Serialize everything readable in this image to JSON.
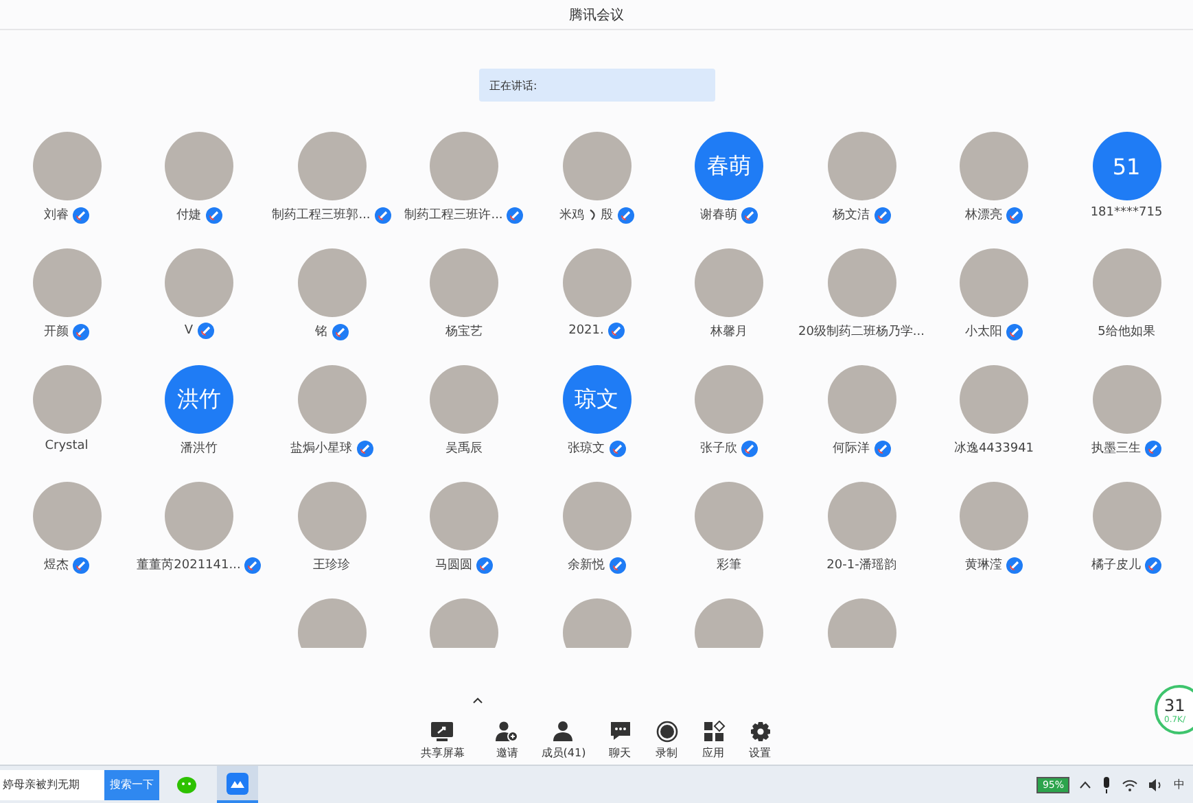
{
  "window": {
    "title": "腾讯会议"
  },
  "speaking": {
    "label": "正在讲话:"
  },
  "participants": [
    {
      "name": "刘睿",
      "verified": true,
      "kind": "photo"
    },
    {
      "name": "付婕",
      "verified": true,
      "kind": "photo"
    },
    {
      "name": "制药工程三班郭...",
      "verified": true,
      "kind": "photo"
    },
    {
      "name": "制药工程三班许...",
      "verified": true,
      "kind": "photo"
    },
    {
      "name": "米鸡",
      "name_end": "殷",
      "verified": true,
      "kind": "photo"
    },
    {
      "name": "谢春萌",
      "verified": true,
      "kind": "initials",
      "initials": "春萌"
    },
    {
      "name": "杨文洁",
      "verified": true,
      "kind": "photo"
    },
    {
      "name": "林漂亮",
      "verified": true,
      "kind": "photo"
    },
    {
      "name": "181****715",
      "verified": false,
      "kind": "initials",
      "initials": "51"
    },
    {
      "name": "开颜",
      "verified": true,
      "kind": "photo"
    },
    {
      "name": "V",
      "verified": true,
      "kind": "photo"
    },
    {
      "name": "铭",
      "verified": true,
      "kind": "photo"
    },
    {
      "name": "杨宝艺",
      "verified": false,
      "kind": "photo"
    },
    {
      "name": "2021.",
      "verified": true,
      "kind": "photo"
    },
    {
      "name": "林馨月",
      "verified": false,
      "kind": "photo"
    },
    {
      "name": "20级制药二班杨乃学...",
      "verified": false,
      "kind": "photo"
    },
    {
      "name": "小太阳",
      "verified": true,
      "kind": "photo"
    },
    {
      "name": "5给他如果",
      "verified": false,
      "kind": "photo"
    },
    {
      "name": "Crystal",
      "verified": false,
      "kind": "photo"
    },
    {
      "name": "潘洪竹",
      "verified": false,
      "kind": "initials",
      "initials": "洪竹"
    },
    {
      "name": "盐焗小星球",
      "verified": true,
      "kind": "photo"
    },
    {
      "name": "吴禹辰",
      "verified": false,
      "kind": "photo"
    },
    {
      "name": "张琼文",
      "verified": true,
      "kind": "initials",
      "initials": "琼文"
    },
    {
      "name": "张子欣",
      "verified": true,
      "kind": "photo"
    },
    {
      "name": "何际洋",
      "verified": true,
      "kind": "photo"
    },
    {
      "name": "冰逸4433941",
      "verified": false,
      "kind": "photo"
    },
    {
      "name": "执墨三生",
      "verified": true,
      "kind": "photo"
    },
    {
      "name": "煜杰",
      "verified": true,
      "kind": "photo"
    },
    {
      "name": "董董芮2021141...",
      "verified": true,
      "kind": "photo"
    },
    {
      "name": "王珍珍",
      "verified": false,
      "kind": "photo"
    },
    {
      "name": "马圆圆",
      "verified": true,
      "kind": "photo"
    },
    {
      "name": "余新悦",
      "verified": true,
      "kind": "photo"
    },
    {
      "name": "彩筆",
      "verified": false,
      "kind": "photo"
    },
    {
      "name": "20-1-潘瑶韵",
      "verified": false,
      "kind": "photo"
    },
    {
      "name": "黄琳滢",
      "verified": true,
      "kind": "photo"
    },
    {
      "name": "橘子皮儿",
      "verified": true,
      "kind": "photo"
    },
    {
      "kind": "photo",
      "verified": false
    },
    {
      "kind": "photo",
      "verified": false
    },
    {
      "kind": "photo",
      "verified": false
    },
    {
      "kind": "photo",
      "verified": false
    },
    {
      "kind": "photo",
      "verified": false
    }
  ],
  "toolbar": [
    {
      "kind": "share",
      "label": "共享屏幕"
    },
    {
      "kind": "invite",
      "label": "邀请"
    },
    {
      "kind": "members",
      "label": "成员(41)"
    },
    {
      "kind": "chat",
      "label": "聊天"
    },
    {
      "kind": "record",
      "label": "录制"
    },
    {
      "kind": "apps",
      "label": "应用"
    },
    {
      "kind": "settings",
      "label": "设置"
    }
  ],
  "network_widget": {
    "value": "31",
    "speed": "0.7K/"
  },
  "taskbar": {
    "search_value": "婷母亲被判无期",
    "search_button": "搜索一下",
    "battery": "95%",
    "ime": "中"
  }
}
